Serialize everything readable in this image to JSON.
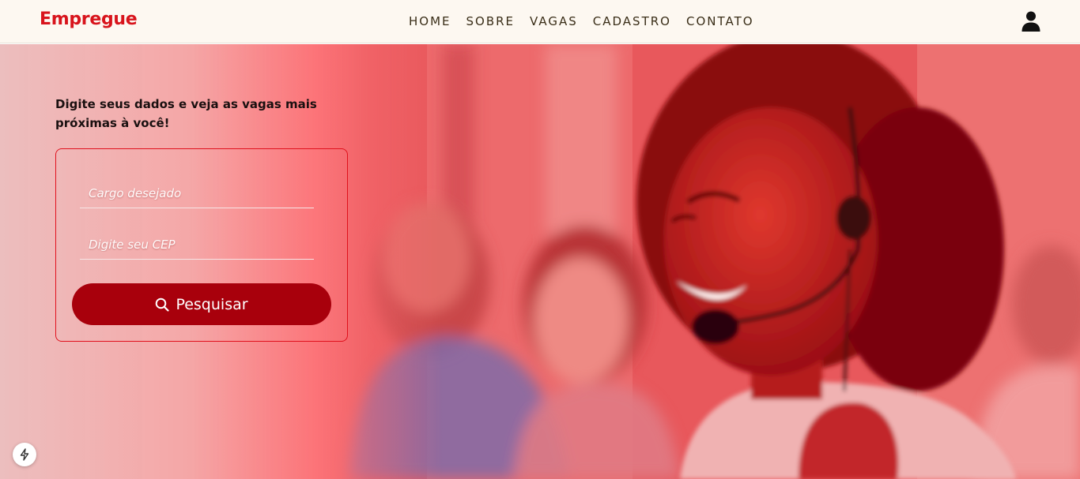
{
  "navbar": {
    "brand": "Empregue",
    "links": [
      "HOME",
      "SOBRE",
      "VAGAS",
      "CADASTRO",
      "CONTATO"
    ],
    "user_icon": "user-icon"
  },
  "hero": {
    "heading": "Digite seus dados e veja as vagas mais próximas à você!",
    "form": {
      "cargo_placeholder": "Cargo desejado",
      "cargo_value": "",
      "cep_placeholder": "Digite seu CEP",
      "cep_value": "",
      "search_label": "Pesquisar",
      "search_icon": "search-icon"
    }
  },
  "floating_badge_icon": "bolt-icon",
  "colors": {
    "brand_red": "#d8141c",
    "button_red": "#a8000c",
    "navbar_bg": "#fdf8f1"
  }
}
